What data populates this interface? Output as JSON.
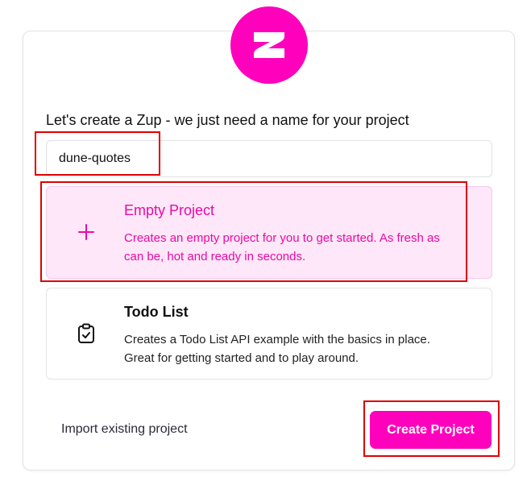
{
  "logo": {
    "icon": "zup-logo-icon",
    "color": "#ff00bd"
  },
  "heading": "Let's create a Zup - we just need a name for your project",
  "project_name": {
    "value": "dune-quotes"
  },
  "options": [
    {
      "title": "Empty Project",
      "description": "Creates an empty project for you to get started. As fresh as can be, hot and ready in seconds.",
      "icon": "plus-icon",
      "selected": true
    },
    {
      "title": "Todo List",
      "description": "Creates a Todo List API example with the basics in place. Great for getting started and to play around.",
      "icon": "clipboard-check-icon",
      "selected": false
    }
  ],
  "footer": {
    "import_label": "Import existing project",
    "create_label": "Create Project"
  },
  "colors": {
    "accent": "#ff00bd",
    "accent_text": "#ea0aa6",
    "selected_bg": "#fde7f8",
    "highlight": "#e00000"
  }
}
